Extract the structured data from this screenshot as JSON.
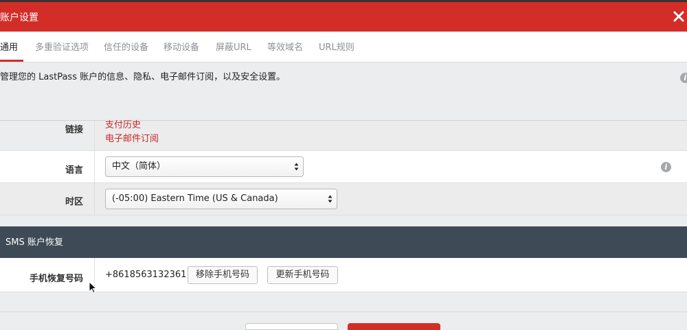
{
  "dialog": {
    "title": "账户设置",
    "accent_color": "#d32d27",
    "close_icon": "close-icon"
  },
  "tabs": [
    {
      "label": "通用",
      "active": true
    },
    {
      "label": "多重验证选项",
      "active": false
    },
    {
      "label": "信任的设备",
      "active": false
    },
    {
      "label": "移动设备",
      "active": false
    },
    {
      "label": "屏蔽URL",
      "active": false
    },
    {
      "label": "等效域名",
      "active": false
    },
    {
      "label": "URL规则",
      "active": false
    }
  ],
  "description": "管理您的 LastPass 账户的信息、隐私、电子邮件订阅，以及安全设置。",
  "rows": {
    "links": {
      "label": "链接",
      "items": [
        "支付历史",
        "电子邮件订阅"
      ]
    },
    "language": {
      "label": "语言",
      "selected": "中文（简体）"
    },
    "timezone": {
      "label": "时区",
      "selected": "(-05:00) Eastern Time (US & Canada)"
    }
  },
  "sms": {
    "section_title": "SMS 账户恢复",
    "label": "手机恢复号码",
    "phone_number": "+8618563132361",
    "remove_button": "移除手机号码",
    "update_button": "更新手机号码"
  },
  "icons": {
    "info": "i"
  }
}
